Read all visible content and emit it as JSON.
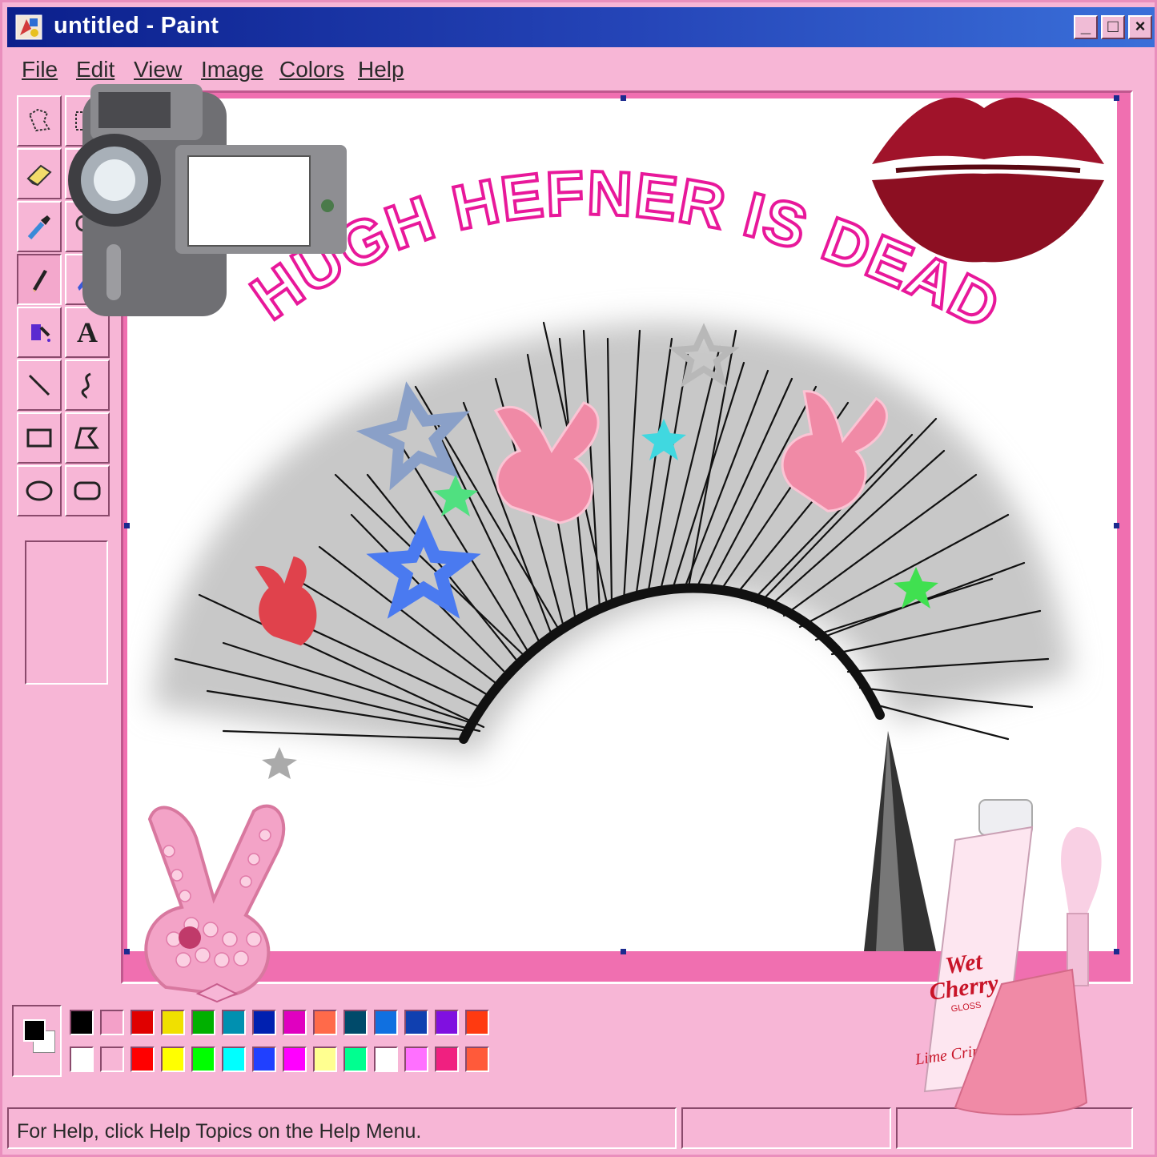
{
  "window": {
    "title": "untitled - Paint",
    "controls": {
      "minimize": "_",
      "maximize": "□",
      "close": "×"
    }
  },
  "menu": [
    "File",
    "Edit",
    "View",
    "Image",
    "Colors",
    "Help"
  ],
  "tools": [
    "free-form-select",
    "rectangle-select",
    "eraser",
    "fill",
    "color-picker",
    "magnifier",
    "pencil",
    "brush",
    "airbrush",
    "text",
    "line",
    "curve",
    "rectangle",
    "polygon",
    "ellipse",
    "rounded-rectangle"
  ],
  "text_tool_glyph": "A",
  "canvas": {
    "headline": "HUGH HEFNER IS DEAD",
    "gloss_brand_line1": "Wet",
    "gloss_brand_line2": "Cherry",
    "gloss_brand_sub": "GLOSS",
    "gloss_maker": "Lime Crime"
  },
  "palette": {
    "foreground": "#000000",
    "background": "#ffffff",
    "top_row": [
      "#000000",
      "#f3a0c8",
      "#e00000",
      "#f0e000",
      "#00b000",
      "#0090b0",
      "#0020b0",
      "#e000c0",
      "#ff6a4a",
      "#004a6a",
      "#1070e0",
      "#1040b0",
      "#8010e0",
      "#ff3a10"
    ],
    "bottom_row": [
      "#ffffff",
      "#f7b6d6",
      "#ff0000",
      "#ffff00",
      "#00ff00",
      "#00ffff",
      "#2040ff",
      "#ff00ff",
      "#ffff90",
      "#00ff90",
      "#ffffff",
      "#ff70ff",
      "#f02080",
      "#ff5a3a"
    ]
  },
  "statusbar": {
    "help": "For Help, click Help Topics on the Help Menu."
  },
  "colors": {
    "title_gradient_start": "#0b1f8c",
    "title_gradient_end": "#3a6fd9",
    "chrome_pink": "#f7b6d6",
    "frame_pink": "#f06fb0",
    "headline_magenta": "#e8189a",
    "lip_red": "#9a1224"
  }
}
